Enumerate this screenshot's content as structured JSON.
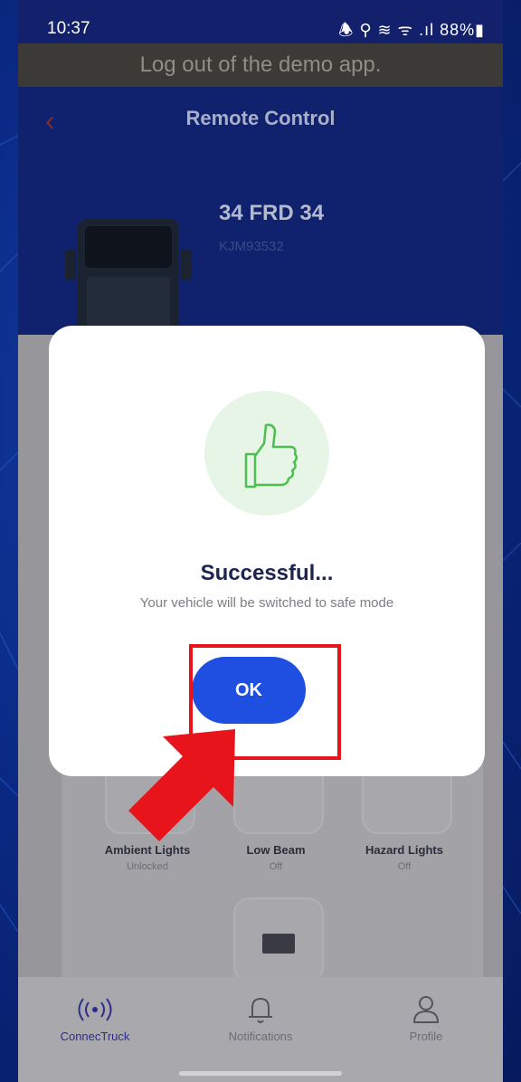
{
  "statusbar": {
    "time": "10:37",
    "indicators": "🕭 ⚲ ≋ ᯤ .ıl 88%▮"
  },
  "banner": {
    "text": "Log out of the demo app."
  },
  "header": {
    "title": "Remote Control",
    "back_icon": "chevron-left-icon",
    "plate": "34 FRD 34",
    "vin": "KJM93532"
  },
  "tiles": [
    {
      "label": "Ambient Lights",
      "status": "Unlocked"
    },
    {
      "label": "Low Beam",
      "status": "Off"
    },
    {
      "label": "Hazard Lights",
      "status": "Off"
    }
  ],
  "modal": {
    "icon": "thumbs-up-icon",
    "heading": "Successful...",
    "message": "Your vehicle will be switched to safe mode",
    "ok_label": "OK"
  },
  "bottom_nav": {
    "items": [
      {
        "label": "ConnecTruck",
        "icon": "broadcast-icon",
        "active": true
      },
      {
        "label": "Notifications",
        "icon": "bell-icon",
        "active": false
      },
      {
        "label": "Profile",
        "icon": "user-icon",
        "active": false
      }
    ]
  },
  "colors": {
    "accent": "#1f4fe0",
    "annotation": "#e8141b",
    "header_bg": "#10226d"
  }
}
